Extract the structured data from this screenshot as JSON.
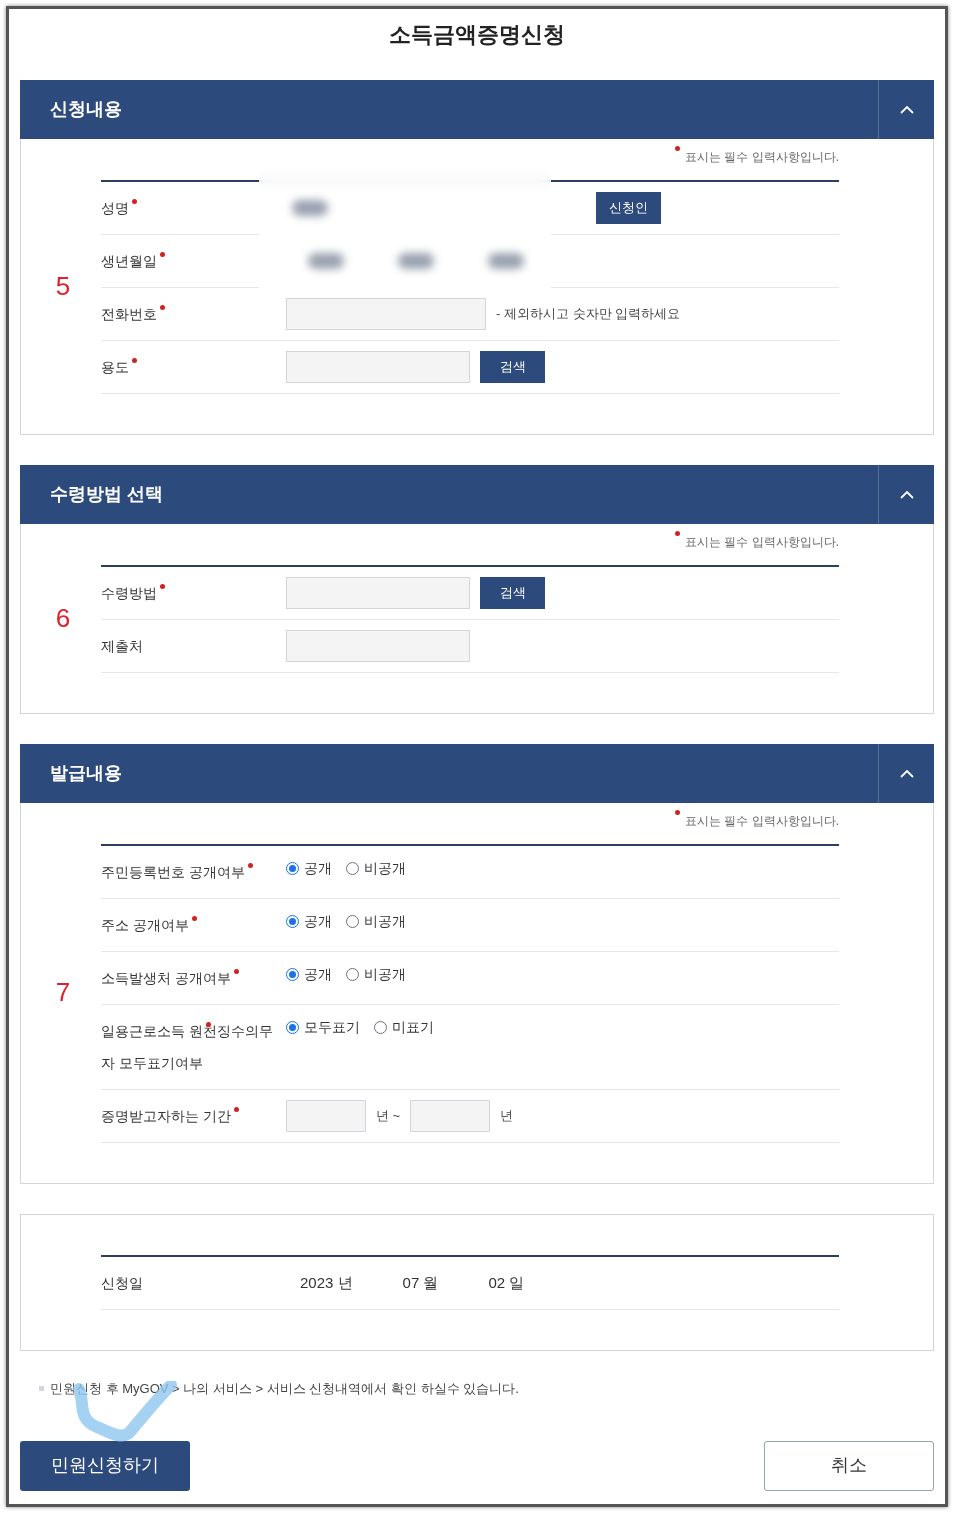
{
  "page_title": "소득금액증명신청",
  "sections": [
    {
      "title": "신청내용",
      "expanded": true,
      "annotation": "5",
      "redacted": true,
      "required_note": "표시는 필수 입력사항입니다.",
      "rows": [
        {
          "label": "성명",
          "required": true,
          "items": [
            {
              "kind": "redacted"
            },
            {
              "kind": "button",
              "label": "신청인"
            }
          ]
        },
        {
          "label": "생년월일",
          "required": true,
          "items": [
            {
              "kind": "redacted"
            },
            {
              "kind": "redacted"
            },
            {
              "kind": "redacted"
            }
          ]
        },
        {
          "label": "전화번호",
          "required": true,
          "items": [
            {
              "kind": "input"
            },
            {
              "kind": "text",
              "text": "- 제외하시고 숫자만 입력하세요"
            }
          ]
        },
        {
          "label": "용도",
          "required": true,
          "items": [
            {
              "kind": "input"
            },
            {
              "kind": "button",
              "label": "검색"
            }
          ]
        }
      ]
    },
    {
      "title": "수령방법 선택",
      "expanded": true,
      "annotation": "6",
      "required_note": "표시는 필수 입력사항입니다.",
      "rows": [
        {
          "label": "수령방법",
          "required": true,
          "items": [
            {
              "kind": "input"
            },
            {
              "kind": "button",
              "label": "검색"
            }
          ]
        },
        {
          "label": "제출처",
          "required": false,
          "items": [
            {
              "kind": "input"
            }
          ]
        }
      ]
    },
    {
      "title": "발급내용",
      "expanded": true,
      "annotation": "7",
      "required_note": "표시는 필수 입력사항입니다.",
      "rows": [
        {
          "label": "주민등록번호 공개여부",
          "required": true,
          "items": [
            {
              "kind": "radio",
              "label": "공개",
              "selected": true
            },
            {
              "kind": "radio",
              "label": "비공개",
              "selected": false
            }
          ]
        },
        {
          "label": "주소 공개여부",
          "required": true,
          "items": [
            {
              "kind": "radio",
              "label": "공개",
              "selected": true
            },
            {
              "kind": "radio",
              "label": "비공개",
              "selected": false
            }
          ]
        },
        {
          "label": "소득발생처 공개여부",
          "required": true,
          "items": [
            {
              "kind": "radio",
              "label": "공개",
              "selected": true
            },
            {
              "kind": "radio",
              "label": "비공개",
              "selected": false
            }
          ]
        },
        {
          "label": "일용근로소득 원천징수의무자 모두표기여부",
          "required": true,
          "items": [
            {
              "kind": "radio",
              "label": "모두표기",
              "selected": true
            },
            {
              "kind": "radio",
              "label": "미표기",
              "selected": false
            }
          ]
        },
        {
          "label": "증명받고자하는 기간",
          "required": true,
          "items": [
            {
              "kind": "year_input"
            },
            {
              "kind": "text",
              "text": "년 ~"
            },
            {
              "kind": "year_input"
            },
            {
              "kind": "text",
              "text": "년"
            }
          ]
        }
      ]
    },
    {
      "rows": [
        {
          "label": "신청일",
          "required": false,
          "items": [
            {
              "kind": "date",
              "text": "2023 년"
            },
            {
              "kind": "date",
              "text": "07 월"
            },
            {
              "kind": "date",
              "text": "02 일"
            }
          ]
        }
      ]
    }
  ],
  "footnote": "민원신청 후 MyGOV > 나의 서비스 > 서비스 신청내역에서 확인 하실수 있습니다.",
  "buttons": [
    {
      "kind": "primary",
      "label": "민원신청하기"
    },
    {
      "kind": "secondary",
      "label": "취소"
    }
  ]
}
